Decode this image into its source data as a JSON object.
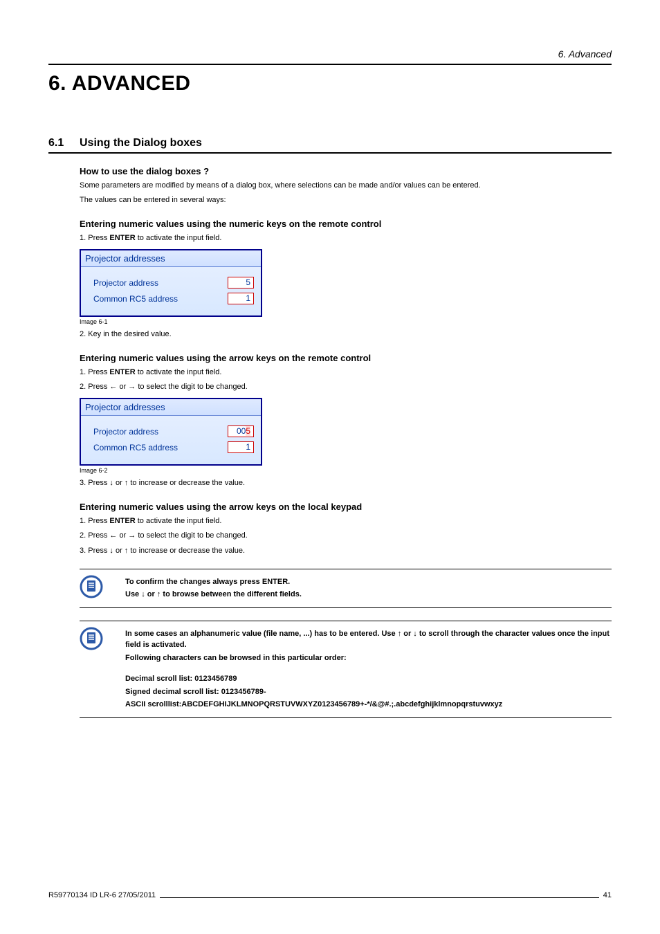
{
  "header": {
    "section": "6. Advanced"
  },
  "chapter": {
    "title": "6. ADVANCED"
  },
  "section": {
    "number": "6.1",
    "title": "Using the Dialog boxes"
  },
  "sub1": {
    "heading": "How to use the dialog boxes ?",
    "p1": "Some parameters are modified by means of a dialog box, where selections can be made and/or values can be entered.",
    "p2": "The values can be entered in several ways:"
  },
  "sub2": {
    "heading": "Entering numeric values using the numeric keys on the remote control",
    "step1_pre": "1.  Press ",
    "step1_bold": "ENTER",
    "step1_post": " to activate the input field.",
    "dialog": {
      "title": "Projector addresses",
      "row1_label": "Projector address",
      "row1_value": "5",
      "row2_label": "Common RC5 address",
      "row2_value": "1"
    },
    "caption": "Image 6-1",
    "step2": "2.  Key in the desired value."
  },
  "sub3": {
    "heading": "Entering numeric values using the arrow keys on the remote control",
    "step1_pre": "1.  Press ",
    "step1_bold": "ENTER",
    "step1_post": " to activate the input field.",
    "step2": "2.  Press ← or → to select the digit to be changed.",
    "dialog": {
      "title": "Projector addresses",
      "row1_label": "Projector address",
      "row1_value_prefix": "00",
      "row1_value_hl": "5",
      "row2_label": "Common RC5 address",
      "row2_value": "1"
    },
    "caption": "Image 6-2",
    "step3": "3.  Press ↓ or ↑ to increase or decrease the value."
  },
  "sub4": {
    "heading": "Entering numeric values using the arrow keys on the local keypad",
    "step1_pre": "1.  Press ",
    "step1_bold": "ENTER",
    "step1_post": " to activate the input field.",
    "step2": "2.  Press ← or → to select the digit to be changed.",
    "step3": "3.  Press ↓ or ↑ to increase or decrease the value."
  },
  "note1": {
    "line1": "To confirm the changes always press ENTER.",
    "line2": "Use ↓ or ↑ to browse between the different fields."
  },
  "note2": {
    "line1": "In some cases an alphanumeric value (file name, ...) has to be entered.  Use ↑ or ↓ to scroll through the character values once the input field is activated.",
    "line2": "Following characters can be browsed in this particular order:",
    "line3": "Decimal scroll list: 0123456789",
    "line4": "Signed decimal scroll list: 0123456789-",
    "line5": "ASCII scrolllist:ABCDEFGHIJKLMNOPQRSTUVWXYZ0123456789+-*/&@#.;.abcdefghijklmnopqrstuvwxyz"
  },
  "footer": {
    "left": "R59770134  ID LR-6  27/05/2011",
    "right": "41"
  }
}
